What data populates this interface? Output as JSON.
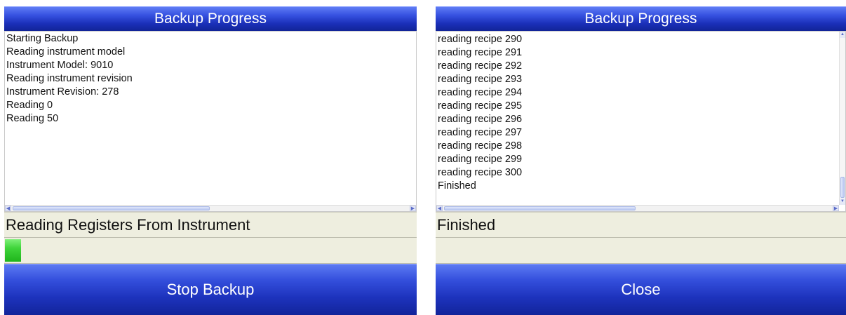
{
  "left": {
    "title": "Backup Progress",
    "log_lines": [
      "Starting Backup",
      "Reading instrument model",
      "Instrument Model: 9010",
      "Reading instrument revision",
      "Instrument Revision: 278",
      "Reading 0",
      "Reading 50"
    ],
    "status": "Reading Registers From Instrument",
    "progress_fraction": 0.04,
    "button_label": "Stop Backup"
  },
  "right": {
    "title": "Backup Progress",
    "log_lines": [
      "reading recipe 290",
      "reading recipe 291",
      "reading recipe 292",
      "reading recipe 293",
      "reading recipe 294",
      "reading recipe 295",
      "reading recipe 296",
      "reading recipe 297",
      "reading recipe 298",
      "reading recipe 299",
      "reading recipe 300",
      "Finished"
    ],
    "status": "Finished",
    "progress_fraction": 0,
    "button_label": "Close"
  },
  "icons": {
    "scroll_left": "scroll-left-arrow-icon",
    "scroll_right": "scroll-right-arrow-icon",
    "scroll_up": "scroll-up-arrow-icon",
    "scroll_down": "scroll-down-arrow-icon"
  },
  "colors": {
    "title_blue": "#1a2fb8",
    "status_bg": "#eeeedf",
    "progress_green": "#3fd43a"
  }
}
